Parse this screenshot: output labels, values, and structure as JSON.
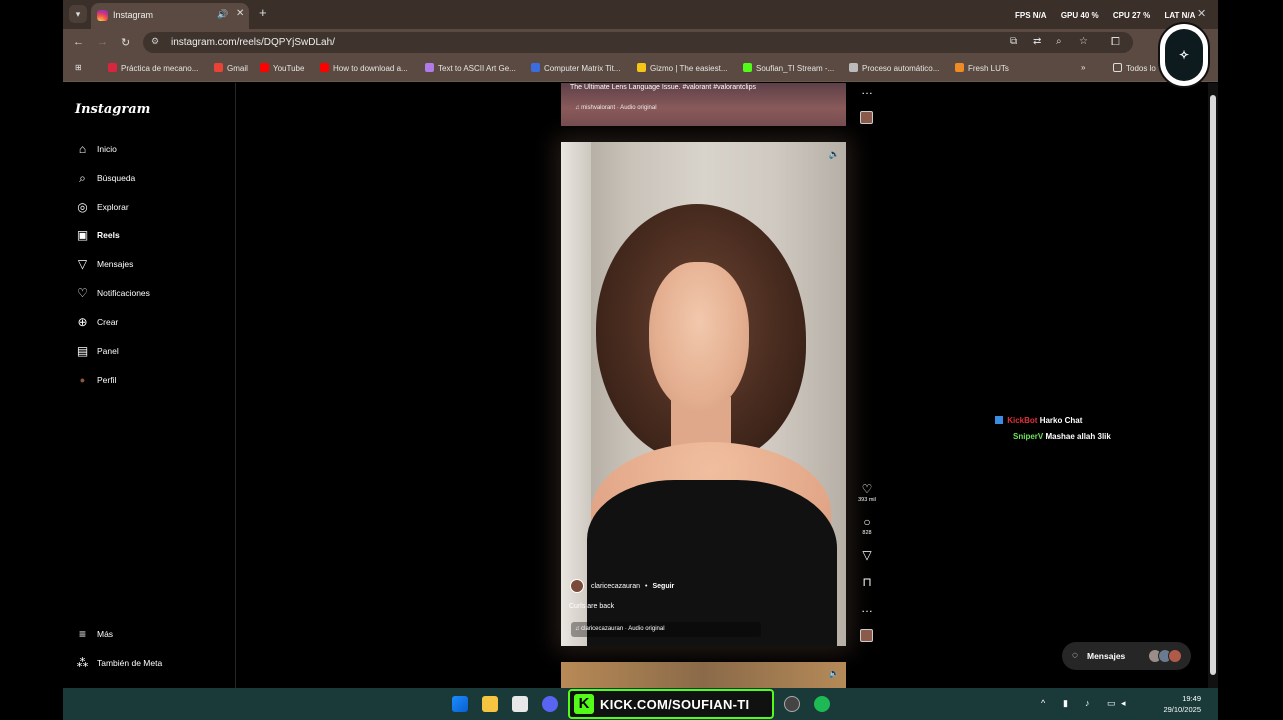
{
  "browser": {
    "tab_title": "Instagram",
    "url": "instagram.com/reels/DQPYjSwDLah/",
    "stats": {
      "fps_label": "FPS",
      "fps_value": "N/A",
      "gpu_label": "GPU",
      "gpu_value": "40 %",
      "cpu_label": "CPU",
      "cpu_value": "27 %",
      "lat_label": "LAT",
      "lat_value": "N/A"
    },
    "bookmarks": [
      {
        "label": "Práctica de mecano...",
        "color": "#d7263d"
      },
      {
        "label": "Gmail",
        "color": "#ea4335"
      },
      {
        "label": "YouTube",
        "color": "#ff0000"
      },
      {
        "label": "How to download a...",
        "color": "#ff0000"
      },
      {
        "label": "Text to ASCII Art Ge...",
        "color": "#b07be8"
      },
      {
        "label": "Computer Matrix Tit...",
        "color": "#3b6de0"
      },
      {
        "label": "Gizmo | The easiest...",
        "color": "#f5c518"
      },
      {
        "label": "Soufian_TI Stream -...",
        "color": "#53fc18"
      },
      {
        "label": "Proceso automático...",
        "color": "#bbbbbb"
      },
      {
        "label": "Fresh LUTs",
        "color": "#f08a24"
      }
    ],
    "all_bookmarks": "Todos lo"
  },
  "sidebar": {
    "logo": "Instagram",
    "items": [
      {
        "label": "Inicio",
        "icon": "home-icon"
      },
      {
        "label": "Búsqueda",
        "icon": "search-icon"
      },
      {
        "label": "Explorar",
        "icon": "compass-icon"
      },
      {
        "label": "Reels",
        "icon": "reels-icon"
      },
      {
        "label": "Mensajes",
        "icon": "send-icon"
      },
      {
        "label": "Notificaciones",
        "icon": "heart-icon"
      },
      {
        "label": "Crear",
        "icon": "plus-icon"
      },
      {
        "label": "Panel",
        "icon": "dashboard-icon"
      },
      {
        "label": "Perfil",
        "icon": "avatar-icon"
      }
    ],
    "more": "Más",
    "meta": "También de Meta"
  },
  "reel_prev": {
    "caption": "The Ultimate Lens Language Issue. #valorant #valorantclips",
    "audio": "mishvalorant · Audio original"
  },
  "reel": {
    "username": "claricecazauran",
    "follow": "Seguir",
    "caption": "Curls are back",
    "audio": "claricecazauran · Audio original",
    "likes": "393 mil",
    "comments": "828"
  },
  "chat": [
    {
      "user": "KickBot",
      "message": "Harko Chat",
      "color": "#e0313a"
    },
    {
      "user": "SniperV",
      "message": "Mashae allah 3lik",
      "color": "#6ee35a"
    }
  ],
  "messages_pill": {
    "label": "Mensajes"
  },
  "taskbar": {
    "kick_label": "KICK.COM/SOUFIAN-TI",
    "time": "19:49",
    "date": "29/10/2025"
  }
}
